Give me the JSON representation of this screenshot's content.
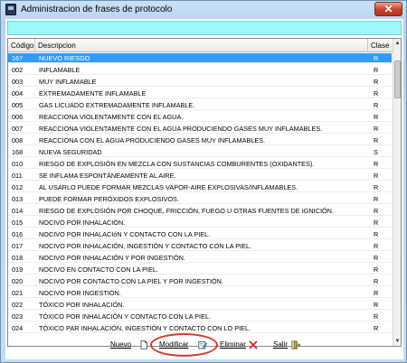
{
  "window": {
    "title": "Administracion de frases de protocolo",
    "close_glyph": "✕"
  },
  "search": {
    "value": ""
  },
  "table": {
    "headers": {
      "code": "Código",
      "description": "Descripcion",
      "clase": "Clase"
    },
    "rows": [
      {
        "code": "167",
        "description": "NUEVO RIESGO",
        "clase": "R",
        "selected": true
      },
      {
        "code": "002",
        "description": "INFLAMABLE",
        "clase": "R"
      },
      {
        "code": "003",
        "description": "MUY INFLAMABLE",
        "clase": "R"
      },
      {
        "code": "004",
        "description": "EXTREMADAMENTE INFLAMABLE",
        "clase": "R"
      },
      {
        "code": "005",
        "description": "GAS LICUADO EXTREMADAMENTE INFLAMABLE.",
        "clase": "R"
      },
      {
        "code": "006",
        "description": "REACCIONA VIOLENTAMENTE CON EL AGUA.",
        "clase": "R"
      },
      {
        "code": "007",
        "description": "REACCIONA VIOLENTAMENTE CON EL AGUA PRODUCIENDO GASES MUY INFLAMABLES.",
        "clase": "R"
      },
      {
        "code": "008",
        "description": "REACCIONA CON EL AGUA PRODUCIENDO GASES MUY INFLAMABLES.",
        "clase": "R"
      },
      {
        "code": "168",
        "description": "NUEVA SEGURIDAD",
        "clase": "S"
      },
      {
        "code": "010",
        "description": "RIESGO DE EXPLOSIÓN EN MEZCLA CON SUSTANCIAS COMBURENTES (OXIDANTES).",
        "clase": "R"
      },
      {
        "code": "011",
        "description": "SE INFLAMA ESPONTÁNEAMENTE AL AIRE.",
        "clase": "R"
      },
      {
        "code": "012",
        "description": "AL USARLO PUEDE FORMAR MEZCLAS VAPOR-AIRE EXPLOSIVAS/INFLAMABLES.",
        "clase": "R"
      },
      {
        "code": "013",
        "description": "PUEDE FORMAR PERÓXIDOS EXPLOSIVOS.",
        "clase": "R"
      },
      {
        "code": "014",
        "description": "RIESGO DE EXPLOSIÓN POR CHOQUE, FRICCIÓN, FUEGO U OTRAS FUENTES DE IGNICIÓN.",
        "clase": "R"
      },
      {
        "code": "015",
        "description": "NOCIVO POR INHALACIÓN.",
        "clase": "R"
      },
      {
        "code": "016",
        "description": "NOCIVO POR INHALACIóN Y CONTACTO CON LA PIEL.",
        "clase": "R"
      },
      {
        "code": "017",
        "description": "NOCIVO POR INHALACIÓN, INGESTIÓN Y CONTACTO CON LA PIEL.",
        "clase": "R"
      },
      {
        "code": "018",
        "description": "NOCIVO POR INHALACIÓN Y POR INGESTIÓN.",
        "clase": "R"
      },
      {
        "code": "019",
        "description": "NOCIVO EN CONTACTO CON LA PIEL.",
        "clase": "R"
      },
      {
        "code": "020",
        "description": "NOCIVO POR CONTACTO CON LA PIEL Y POR INGESTIÓN.",
        "clase": "R"
      },
      {
        "code": "021",
        "description": "NOCIVO POR INGESTIÓN.",
        "clase": "R"
      },
      {
        "code": "022",
        "description": "TÓXICO POR INHALACIÓN.",
        "clase": "R"
      },
      {
        "code": "023",
        "description": "TÓXICO POR INHALACIÓN Y CONTACTO CON LA PIEL.",
        "clase": "R"
      },
      {
        "code": "024",
        "description": "TÓXICO PAR INHALACIÓN, INGESTIÓN Y CONTACTO CON LO PIEL.",
        "clase": "R"
      }
    ]
  },
  "scrollbar": {
    "up_glyph": "▲",
    "down_glyph": "▼",
    "position_fraction": 0.05
  },
  "toolbar": {
    "nuevo": {
      "label": "Nuevo",
      "icon": "new-document-icon"
    },
    "modificar": {
      "label": "Modificar",
      "icon": "edit-icon"
    },
    "eliminar": {
      "label": "Eliminar",
      "icon": "delete-x-icon"
    },
    "salir": {
      "label": "Salir",
      "icon": "exit-door-icon"
    }
  },
  "colors": {
    "selection": "#3399ff",
    "search_bg": "#9ff7f9",
    "highlight_ring": "#d23a2f",
    "delete_icon": "#d42b2b"
  }
}
